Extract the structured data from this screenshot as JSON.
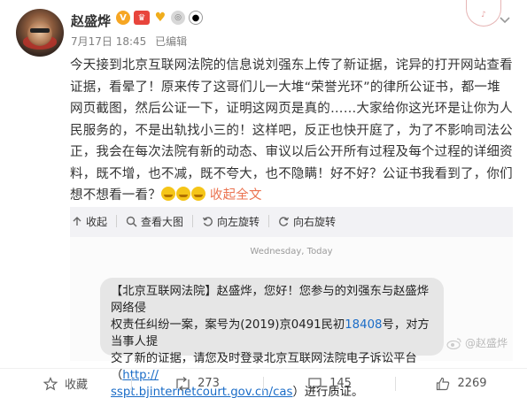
{
  "author": {
    "name": "赵盛烨",
    "timestamp": "7月17日 18:45",
    "edited": "已编辑"
  },
  "post": {
    "text": "今天接到北京互联网法院的信息说刘强东上传了新证据，诧异的打开网站查看证据，看晕了！原来传了这哥们儿一大堆“荣誉光环”的律所公证书，都一堆网页截图，然后公证一下，证明这网页是真的……大家给你这光环是让你为人民服务的，不是出轨找小三的！这样吧，反正也快开庭了，为了不影响司法公正，我会在每次法院有新的动态、审议以后公开所有过程及每个过程的详细资料，既不增，也不减，既不夸大，也不隐瞒！好不好？公证书我看到了，你们想不想看一看？",
    "collapse_label": "收起全文"
  },
  "image_tools": {
    "collapse": "收起",
    "view_large": "查看大图",
    "rotate_left": "向左旋转",
    "rotate_right": "向右旋转"
  },
  "screenshot": {
    "date": "Wednesday, Today",
    "message_line1": "【北京互联网法院】赵盛烨，您好！您参与的刘强东与赵盛烨网络侵",
    "message_line2": "权责任纠纷一案，案号为(2019)京0491民初",
    "case_number": "18408",
    "message_line2b": "号，对方当事人提",
    "message_line3": "交了新的证据，请您及时登录北京互联网法院电子诉讼平台（",
    "link_part1": "http://",
    "link_part2": "sspt.bjinternetcourt.gov.cn/cas",
    "message_line4_end": "）进行质证。",
    "watermark": "@赵盛烨"
  },
  "footer": {
    "favorite": "收藏",
    "reposts": "273",
    "comments": "145",
    "likes": "2269"
  },
  "colors": {
    "accent": "#eb7350",
    "link": "#1a6cc7",
    "media_bg": "#f2f2f5"
  }
}
